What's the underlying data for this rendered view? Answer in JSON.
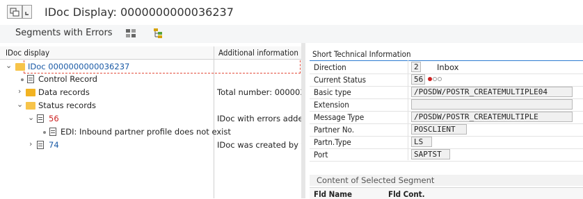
{
  "window": {
    "title": "IDoc Display: 0000000000036237"
  },
  "toolbar": {
    "segments_with_errors": "Segments with Errors"
  },
  "tree": {
    "col_idoc": "IDoc display",
    "col_info": "Additional information",
    "rows": [
      {
        "label": "IDoc 0000000000036237",
        "info": ""
      },
      {
        "label": "Control Record",
        "info": ""
      },
      {
        "label": "Data records",
        "info": "Total number: 000003"
      },
      {
        "label": "Status records",
        "info": ""
      },
      {
        "label": "56",
        "info": "IDoc with errors added"
      },
      {
        "label": "EDI: Inbound partner profile does not exist",
        "info": ""
      },
      {
        "label": "74",
        "info": "IDoc was created by tes"
      }
    ]
  },
  "tech_info": {
    "header": "Short Technical Information",
    "direction": {
      "label": "Direction",
      "code": "2",
      "text": "Inbox"
    },
    "current_status": {
      "label": "Current Status",
      "code": "56"
    },
    "basic_type": {
      "label": "Basic type",
      "value": "/POSDW/POSTR_CREATEMULTIPLE04"
    },
    "extension": {
      "label": "Extension",
      "value": ""
    },
    "message_type": {
      "label": "Message Type",
      "value": "/POSDW/POSTR_CREATEMULTIPLE"
    },
    "partner_no": {
      "label": "Partner No.",
      "value": "POSCLIENT"
    },
    "partn_type": {
      "label": "Partn.Type",
      "value": "LS"
    },
    "port": {
      "label": "Port",
      "value": "SAPTST"
    }
  },
  "segment": {
    "header": "Content of Selected Segment",
    "col_fld_name": "Fld Name",
    "col_fld_cont": "Fld Cont."
  },
  "colors": {
    "status_red": "#cc2222",
    "link_blue": "#1a5aa6",
    "error_red": "#cc2222"
  }
}
